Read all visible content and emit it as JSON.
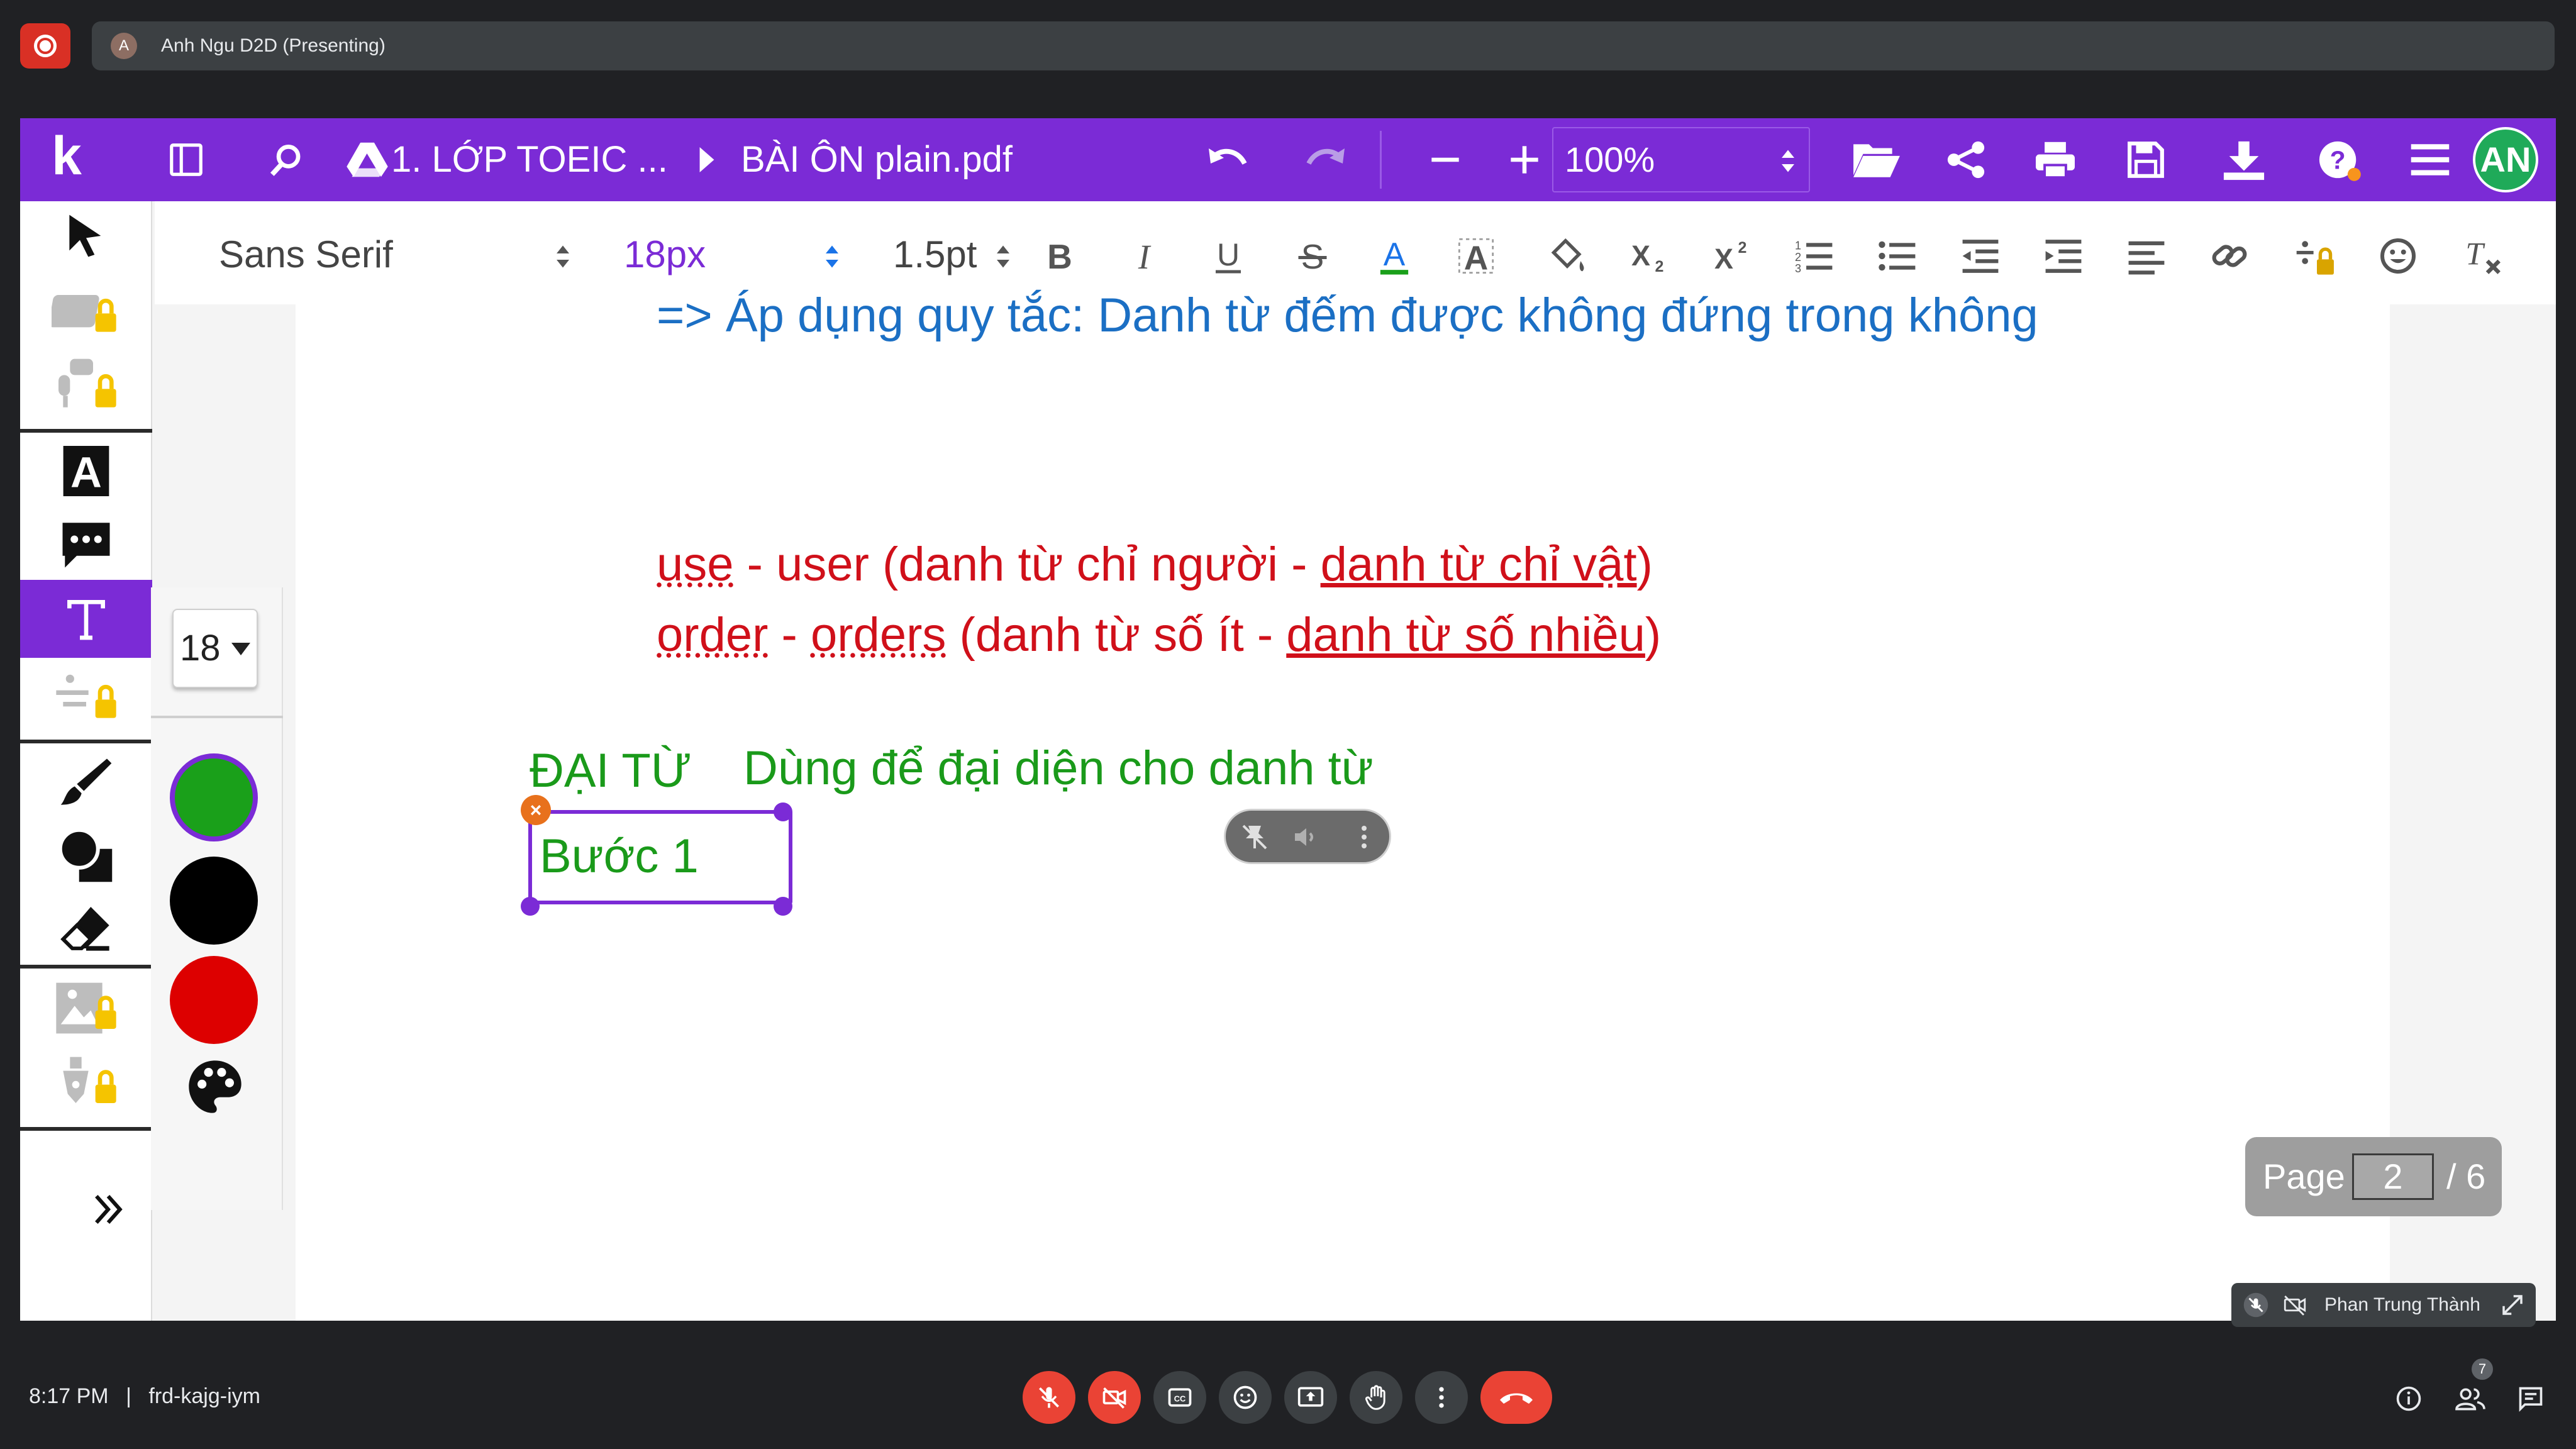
{
  "meet": {
    "presenter_initial": "A",
    "presenter_label": "Anh Ngu D2D (Presenting)",
    "time": "8:17 PM",
    "separator": "|",
    "meeting_code": "frd-kajg-iym",
    "participant_count": "7",
    "pip_name": "Phan Trung Thành"
  },
  "app": {
    "logo": "k",
    "breadcrumb_folder": "1. LỚP TOEIC ...",
    "file_name": "BÀI ÔN plain.pdf",
    "zoom": "100%",
    "user_initials": "AN",
    "accent_color": "#7b2bd6"
  },
  "format": {
    "font_family": "Sans Serif",
    "font_size": "18px",
    "line_height": "1.5pt"
  },
  "side_panel": {
    "font_size": "18",
    "colors": [
      "#1aa01a",
      "#000000",
      "#dd0000"
    ]
  },
  "document": {
    "line_top": "=> Áp dụng quy tắc: Danh từ đếm được không đứng trong không",
    "line1": {
      "w1": "use",
      "sep1": " - ",
      "w2": "user",
      "mid": " (danh từ chỉ người - ",
      "u": "danh từ chỉ vật",
      "end": ")"
    },
    "line2": {
      "w1": "order",
      "sep1": " - ",
      "w2": "orders",
      "mid": " (danh từ số ít - ",
      "u": "danh từ số nhiều",
      "end": ")"
    },
    "heading": "ĐẠI TỪ",
    "definition": "Dùng để đại diện cho danh từ",
    "textbox": "Bước 1"
  },
  "pager": {
    "label": "Page",
    "current": "2",
    "total": "/ 6"
  }
}
